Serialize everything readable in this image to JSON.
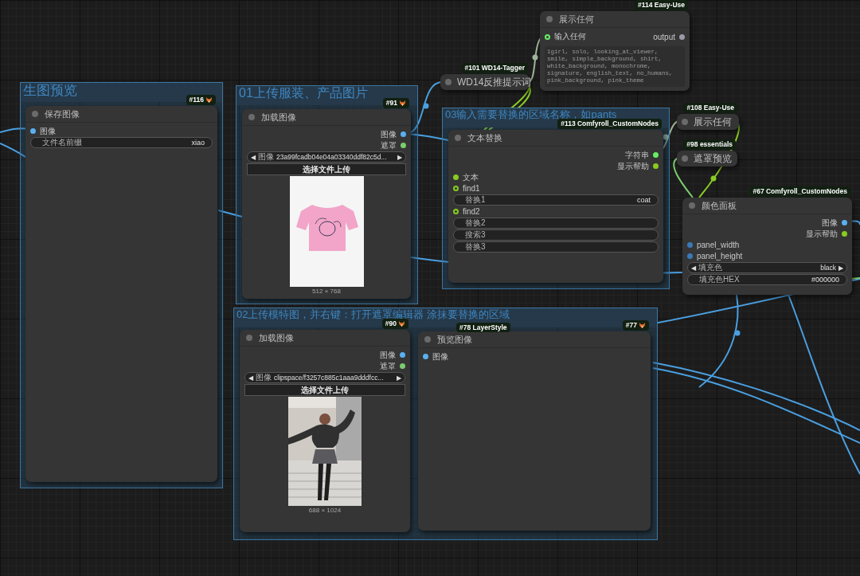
{
  "groups": [
    {
      "title": "生图预览"
    },
    {
      "title": "01上传服装、产品图片"
    },
    {
      "title": "03输入需要替换的区域名称，如pants"
    },
    {
      "title": "02上传模特图，并右键：打开遮罩编辑器 涂抹要替换的区域"
    }
  ],
  "nodes": [
    {
      "badge": "#116",
      "badge_icon": true,
      "title": "保存图像",
      "collapsed": false,
      "rows": [
        {
          "kind": "input",
          "label": "图像",
          "color": "#5ab0f0",
          "linked": true
        },
        {
          "kind": "field",
          "label": "文件名前缀",
          "value": "xiao"
        }
      ]
    },
    {
      "badge": "#91",
      "badge_icon": true,
      "title": "加载图像",
      "collapsed": false,
      "rows": [
        {
          "kind": "output",
          "label": "图像",
          "color": "#5ab0f0",
          "linked": true
        },
        {
          "kind": "output",
          "label": "遮罩",
          "color": "#7ccc6e",
          "linked": true
        },
        {
          "kind": "combo",
          "prev": "◀",
          "label": "图像",
          "value": "23a99fcadb04e04a03340ddf82c5d...",
          "next": "▶"
        },
        {
          "kind": "button",
          "label": "选择文件上传"
        },
        {
          "kind": "picture"
        },
        {
          "kind": "caption",
          "text": "512 × 768"
        }
      ]
    },
    {
      "badge": "#101 WD14-Tagger",
      "badge_icon": false,
      "title": "WD14反推提示词",
      "collapsed": true
    },
    {
      "badge": "#114 Easy-Use",
      "badge_icon": false,
      "title": "展示任何",
      "collapsed": false,
      "rows": [
        {
          "kind": "pair",
          "label": "输入任何",
          "color": "#66ee66",
          "linked": false,
          "out_label": "output"
        },
        {
          "kind": "textarea",
          "text": "1girl, solo, looking_at_viewer, smile, simple_background, shirt, white_background, monochrome, signature, english_text, no_humans, pink_background, pink_theme"
        }
      ]
    },
    {
      "badge": "#113 Comfyroll_CustomNodes",
      "badge_icon": false,
      "title": "文本替换",
      "collapsed": false,
      "rows": [
        {
          "kind": "output",
          "label": "字符串",
          "color": "#66ee66",
          "linked": true
        },
        {
          "kind": "output",
          "label": "显示帮助",
          "color": "#88cc22",
          "linked": true
        },
        {
          "kind": "input",
          "label": "文本",
          "color": "#88cc22",
          "linked": true
        },
        {
          "kind": "input",
          "label": "find1",
          "color": "#88cc22",
          "linked": false
        },
        {
          "kind": "field",
          "label": "替换1",
          "value": "coat"
        },
        {
          "kind": "input",
          "label": "find2",
          "color": "#88cc22",
          "linked": false
        },
        {
          "kind": "field",
          "label": "替换2"
        },
        {
          "kind": "field",
          "label": "搜索3"
        },
        {
          "kind": "field",
          "label": "替换3"
        }
      ]
    },
    {
      "badge": "#108 Easy-Use",
      "badge_icon": false,
      "title": "展示任何",
      "collapsed": true
    },
    {
      "badge": "#98 essentials",
      "badge_icon": false,
      "title": "遮罩预览",
      "collapsed": true
    },
    {
      "badge": "#67 Comfyroll_CustomNodes",
      "badge_icon": false,
      "title": "颜色面板",
      "collapsed": false,
      "rows": [
        {
          "kind": "output",
          "label": "图像",
          "color": "#5ab0f0",
          "linked": true
        },
        {
          "kind": "output",
          "label": "显示帮助",
          "color": "#88cc22",
          "linked": true
        },
        {
          "kind": "input",
          "label": "panel_width",
          "color": "#3a7ab8",
          "linked": true
        },
        {
          "kind": "input",
          "label": "panel_height",
          "color": "#3a7ab8",
          "linked": true
        },
        {
          "kind": "combo",
          "prev": "◀",
          "label": "填充色",
          "value": "black",
          "next": "▶"
        },
        {
          "kind": "field",
          "label": "填充色HEX",
          "value": "#000000"
        }
      ]
    },
    {
      "badge": "#90",
      "badge_icon": true,
      "title": "加载图像",
      "collapsed": false,
      "rows": [
        {
          "kind": "output",
          "label": "图像",
          "color": "#5ab0f0",
          "linked": true
        },
        {
          "kind": "output",
          "label": "遮罩",
          "color": "#7ccc6e",
          "linked": true
        },
        {
          "kind": "combo",
          "prev": "◀",
          "label": "图像",
          "value": "clipspace/f3257c885c1aaa9dddfcc...",
          "next": "▶"
        },
        {
          "kind": "button",
          "label": "选择文件上传"
        },
        {
          "kind": "picture"
        },
        {
          "kind": "caption",
          "text": "688 × 1024"
        }
      ]
    },
    {
      "badge": "#77",
      "badge_icon": true,
      "title": "预览图像",
      "collapsed": false,
      "rows": [
        {
          "kind": "input",
          "label": "图像",
          "color": "#5ab0f0",
          "linked": true
        }
      ]
    }
  ],
  "loose_badges": [
    {
      "text": "#78 LayerStyle"
    }
  ]
}
